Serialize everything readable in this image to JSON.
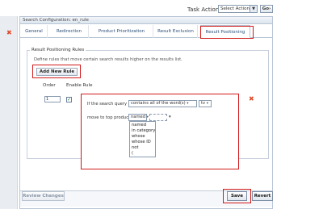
{
  "toolbar": {
    "task_action_label": "Task Action:",
    "task_action_value": "Select Action",
    "go_label": "Go›"
  },
  "panel": {
    "header": "Search Configuration: en_rule"
  },
  "tabs": [
    {
      "label": "General"
    },
    {
      "label": "Redirection"
    },
    {
      "label": "Product Prioritization"
    },
    {
      "label": "Result Exclusion"
    },
    {
      "label": "Result Positioning"
    }
  ],
  "section": {
    "legend": "Result Positioning Rules",
    "description": "Define rules that move certain search results higher on the results list.",
    "add_rule_label": "Add New Rule",
    "columns": {
      "order": "Order",
      "enable": "Enable Rule"
    }
  },
  "rule": {
    "order_value": "1",
    "enabled": true,
    "if_label": "If the search query",
    "match_select": "contains all of the word(s)",
    "term_value": "tv",
    "move_label": "move to top products",
    "product_select": "named",
    "product_value": ""
  },
  "dropdown_options": [
    "named",
    "in category",
    "whose",
    "whose ID",
    "not",
    "("
  ],
  "footer": {
    "review_label": "Review Changes",
    "save_label": "Save",
    "revert_label": "Revert"
  },
  "colors": {
    "highlight": "#d11a1a",
    "delete_icon": "#e04a2a",
    "tab_text": "#2d4f7a"
  }
}
